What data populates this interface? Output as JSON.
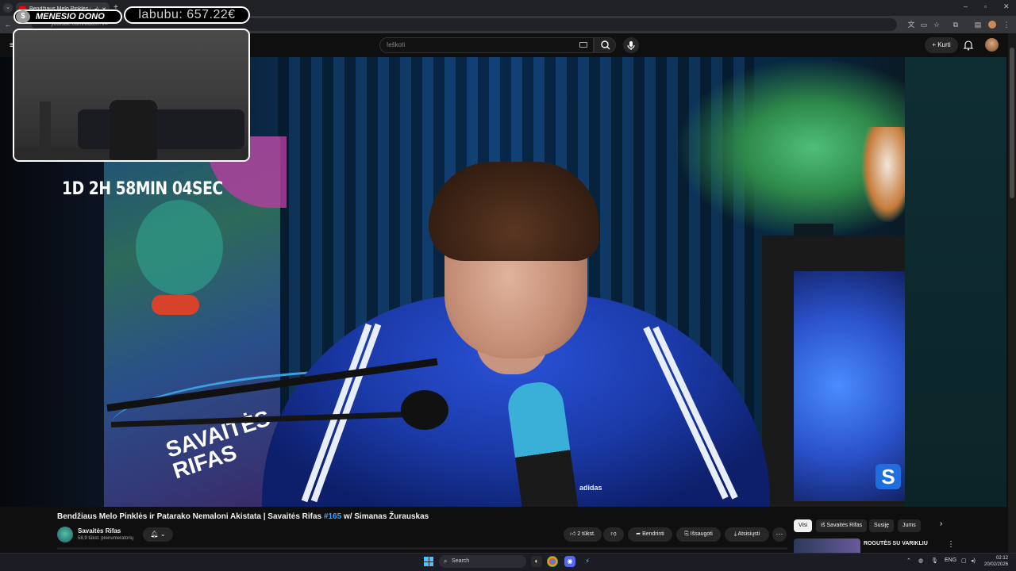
{
  "browser": {
    "tab_title": "Bendžiaus Melo Pinklės ir P",
    "url": "youtube.com/watch?v=",
    "win_controls": [
      "–",
      "▫",
      "✕"
    ]
  },
  "youtube": {
    "search_placeholder": "Ieškoti",
    "create_label": "Kurti"
  },
  "overlay": {
    "dono_label": "MENESIO DONO",
    "dono_coin": "$",
    "amount": "labubu: 657.22€",
    "timer": "1D 2H 58MIN 04SEC"
  },
  "video_scene": {
    "poster_text": "SAVAITĖS RIFAS",
    "brand_text": "adidas",
    "corner_logo": "S"
  },
  "video": {
    "title_prefix": "Bendžiaus Melo Pinklės ir Patarako Nemaloni Akistata | Savaitės Rifas ",
    "title_hashtag": "#165",
    "title_suffix": " w/ Simanas Žurauskas",
    "channel_name": "Savaitės Rifas",
    "subscribers": "58,9 tūkst. prenumeratorių",
    "likes": "2 tūkst.",
    "share": "Bendrinti",
    "save": "Išsaugoti",
    "download": "Atsisiųsti",
    "more": "···"
  },
  "sidebar": {
    "chips": [
      "Visi",
      "Iš Savaitės Rifas",
      "Susiję",
      "Jums"
    ],
    "next_chip": "›",
    "rec_title": "ROGUTĖS SU VARIKLIU"
  },
  "taskbar": {
    "search_label": "Search",
    "language": "ENG",
    "time": "02:12",
    "date": "20/02/2026"
  },
  "colors": {
    "accent_blue": "#3ea6ff",
    "yt_red": "#ff0000",
    "windows_blue": "#4cc2ff"
  }
}
